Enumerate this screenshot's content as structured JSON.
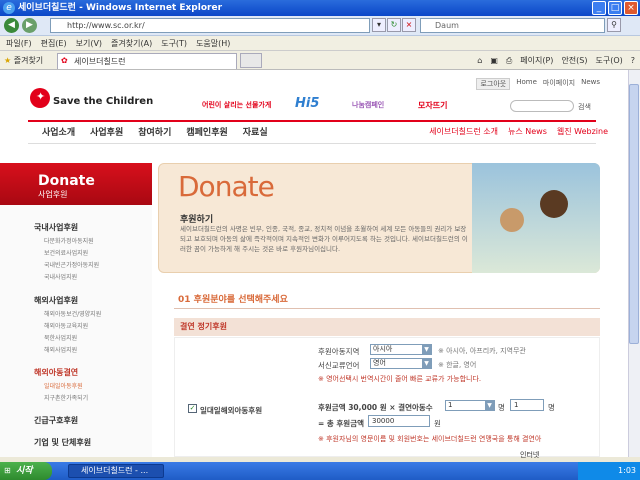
{
  "window": {
    "title": "세이브더칠드런 - Windows Internet Explorer"
  },
  "address": {
    "url": "http://www.sc.or.kr/",
    "search_placeholder": "Daum"
  },
  "menu": [
    "파일(F)",
    "편집(E)",
    "보기(V)",
    "즐겨찾기(A)",
    "도구(T)",
    "도움말(H)"
  ],
  "favbar": {
    "favorites": "즐겨찾기",
    "tab": "세이브더칠드런",
    "tools": [
      "페이지(P)",
      "안전(S)",
      "도구(O)"
    ]
  },
  "site": {
    "logo": "Save the Children",
    "toplinks": [
      "로그아웃",
      "Home",
      "마이페이지",
      "News"
    ],
    "promos": [
      "어린이 살리는 선물가게",
      "Hi5",
      "나눔캠페인",
      "모자뜨기"
    ],
    "search_label": "검색",
    "mainnav": [
      "사업소개",
      "사업후원",
      "참여하기",
      "캠페인후원",
      "자료실"
    ],
    "subnav": [
      "세이브더칠드런 소개",
      "뉴스 News",
      "웹진 Webzine"
    ]
  },
  "sidebar": {
    "title": "Donate",
    "subtitle": "사업후원",
    "sections": [
      {
        "label": "국내사업후원",
        "items": [
          "다문화가정아동지원",
          "보건의료사업지원",
          "국내빈곤가정아동지원",
          "국내사업지원"
        ]
      },
      {
        "label": "해외사업후원",
        "items": [
          "해외아동보건/영양지원",
          "해외아동교육지원",
          "북한사업지원",
          "해외사업지원"
        ]
      },
      {
        "label": "해외아동결연",
        "items": [
          "일대일아동후원",
          "지구촌한가족되기"
        ]
      },
      {
        "label": "긴급구호후원",
        "items": []
      },
      {
        "label": "기업 및 단체후원",
        "items": []
      }
    ]
  },
  "banner": {
    "title": "Donate",
    "subtitle": "후원하기",
    "desc": "세이브더칠드런의 사명은 빈부, 인종, 국적, 종교, 정치적 이념을 초월하여 세계 모든 아동들의 권리가 보장되고 보호되며 아동의 삶에 즉각적이며 지속적인 변화가 이루어지도록 하는 것입니다. 세이브더칠드런의 이러한 꿈이 가능하게 해 주시는 것은 바로 후원자님이십니다."
  },
  "form": {
    "step": "01  후원분야를 선택해주세요",
    "category": "결연 정기후원",
    "option_label": "일대일해외아동후원",
    "region_label": "후원아동지역",
    "region_value": "아시아",
    "region_note": "※ 아시아, 아프리카, 지역무관",
    "language_label": "서신교류언어",
    "language_value": "영어",
    "language_note": "※ 한글, 영어",
    "english_note": "※ 영어선택시 번역시간이 줄어 빠른 교류가 가능합니다.",
    "amount_label": "후원금액 30,000 원 × 결연아동수",
    "child_count": "1",
    "unit_name": "명",
    "unit_input": "1",
    "total_label": "= 총 후원금액",
    "total_value": "30000",
    "won": "원",
    "bottom_note": "※ 후원자님의 영문이름 및 회원번호는 세이브더칠드런 연맹국을 통해 결연아"
  },
  "taskbar": {
    "start": "시작",
    "item": "세이브더칠드런 - ...",
    "status": "인터넷",
    "clock": "1:03"
  },
  "colors": {
    "brand_red": "#e2001a",
    "accent_orange": "#d96a3a",
    "xp_blue": "#2a6cdc"
  }
}
